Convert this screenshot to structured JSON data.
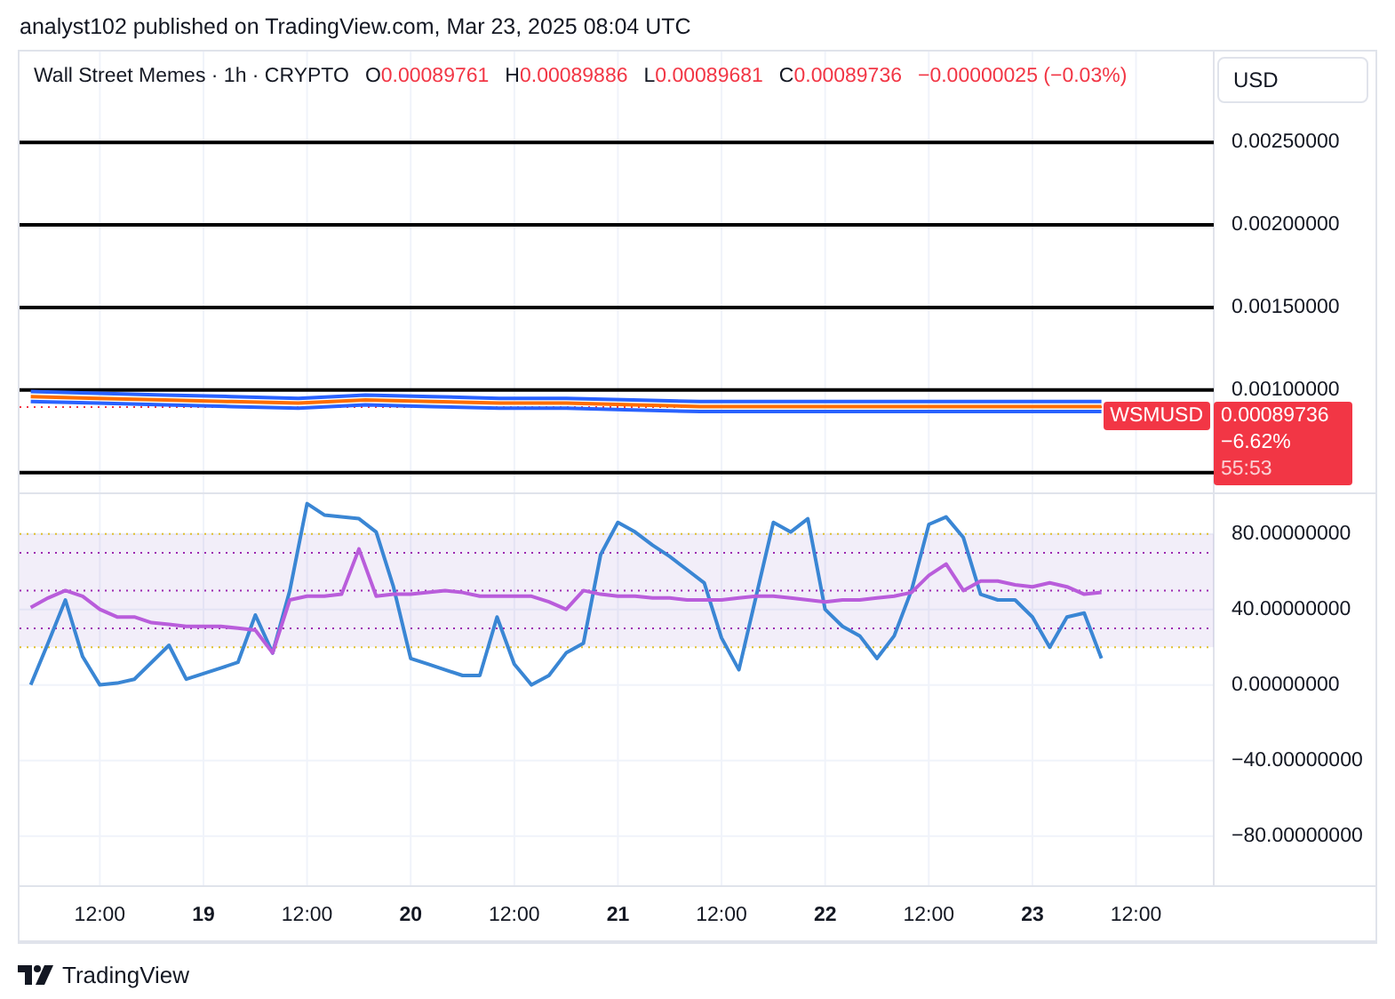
{
  "header": {
    "text": "analyst102 published on TradingView.com, Mar 23, 2025 08:04 UTC"
  },
  "legend": {
    "symbol": "Wall Street Memes · 1h · CRYPTO",
    "ohlc": [
      {
        "label": "O",
        "value": "0.00089761"
      },
      {
        "label": "H",
        "value": "0.00089886"
      },
      {
        "label": "L",
        "value": "0.00089681"
      },
      {
        "label": "C",
        "value": "0.00089736"
      }
    ],
    "change": "−0.00000025 (−0.03%)"
  },
  "currency_button": "USD",
  "price_pane": {
    "symbol_tag": "WSMUSD",
    "last_price": "0.00089736",
    "change_percent": "−6.62%",
    "countdown": "55:53",
    "chart_data": {
      "type": "line",
      "ylim": [
        0.00038,
        0.00305
      ],
      "categories": [
        null,
        null,
        null,
        null,
        null,
        null,
        null,
        null,
        null,
        null,
        null,
        null,
        null,
        null,
        null,
        null,
        null
      ],
      "yticks": [
        {
          "value": 0.0025,
          "label": "0.00250000"
        },
        {
          "value": 0.002,
          "label": "0.00200000"
        },
        {
          "value": 0.0015,
          "label": "0.00150000"
        },
        {
          "value": 0.001,
          "label": "0.00100000"
        }
      ],
      "series": [
        {
          "color": "#2962ff",
          "values": [
            0.00099,
            0.00098,
            0.00097,
            0.00096,
            0.00095,
            0.00097,
            0.00096,
            0.00095,
            0.00095,
            0.00094,
            0.00093,
            0.00093,
            0.00093,
            0.00093,
            0.00093,
            0.00093,
            0.00093
          ]
        },
        {
          "color": "#2962ff",
          "values": [
            0.00093,
            0.00092,
            0.00091,
            0.0009,
            0.00089,
            0.00091,
            0.0009,
            0.00089,
            0.00089,
            0.00088,
            0.00087,
            0.00087,
            0.00087,
            0.00087,
            0.00087,
            0.00087,
            0.00087
          ]
        },
        {
          "color": "#ff6d00",
          "values": [
            0.00096,
            0.00095,
            0.00094,
            0.00093,
            0.00092,
            0.00094,
            0.00093,
            0.00092,
            0.00092,
            0.00091,
            0.0009,
            0.0009,
            0.0009,
            0.0009,
            0.0009,
            0.0009,
            0.0009
          ]
        }
      ],
      "grid": true,
      "ref_lines": [
        {
          "axis": "y",
          "value": 0.0025,
          "color": "#000000"
        },
        {
          "axis": "y",
          "value": 0.002,
          "color": "#000000"
        },
        {
          "axis": "y",
          "value": 0.0015,
          "color": "#000000"
        },
        {
          "axis": "y",
          "value": 0.001,
          "color": "#000000"
        },
        {
          "axis": "y",
          "value": 0.0005,
          "color": "#000000"
        },
        {
          "axis": "y",
          "value": 0.00089736,
          "color": "#f23645"
        }
      ]
    }
  },
  "oscillator_pane": {
    "chart_data": {
      "type": "line",
      "ylim": [
        -107,
        101
      ],
      "categories": [
        null,
        null,
        null,
        null,
        "12:00",
        null,
        null,
        null,
        null,
        null,
        "19",
        null,
        null,
        null,
        null,
        null,
        "12:00",
        null,
        null,
        null,
        null,
        null,
        "20",
        null,
        null,
        null,
        null,
        null,
        "12:00",
        null,
        null,
        null,
        null,
        null,
        "21",
        null,
        null,
        null,
        null,
        null,
        "12:00",
        null,
        null,
        null,
        null,
        null,
        "22",
        null,
        null,
        null,
        null,
        null,
        "12:00",
        null,
        null,
        null,
        null,
        null,
        "23",
        null,
        null,
        null,
        null,
        null,
        "12:00"
      ],
      "yticks": [
        {
          "value": 80,
          "label": "80.00000000"
        },
        {
          "value": 40,
          "label": "40.00000000"
        },
        {
          "value": 0,
          "label": "0.00000000"
        },
        {
          "value": -40,
          "label": "−40.00000000"
        },
        {
          "value": -80,
          "label": "−80.00000000"
        }
      ],
      "series": [
        {
          "color": "#3a86d4",
          "values": [
            0,
            22,
            45,
            15,
            0,
            1,
            3,
            12,
            21,
            3,
            6,
            9,
            12,
            37,
            17,
            50,
            96,
            90,
            89,
            88,
            81,
            52,
            14,
            11,
            8,
            5,
            5,
            36,
            11,
            0,
            5,
            17,
            22,
            69,
            86,
            81,
            74,
            68,
            61,
            54,
            25,
            8,
            47,
            86,
            81,
            88,
            40,
            31,
            26,
            14,
            26,
            50,
            85,
            89,
            78,
            48,
            45,
            45,
            36,
            20,
            36,
            38,
            14,
            null,
            null
          ]
        },
        {
          "color": "#b95ddb",
          "values": [
            41,
            46,
            50,
            47,
            40,
            36,
            36,
            33,
            32,
            31,
            31,
            31,
            30,
            29,
            17,
            45,
            47,
            47,
            48,
            72,
            47,
            48,
            48,
            49,
            50,
            49,
            47,
            47,
            47,
            47,
            44,
            40,
            50,
            48,
            47,
            47,
            46,
            46,
            45,
            45,
            45,
            46,
            47,
            47,
            46,
            45,
            44,
            45,
            45,
            46,
            47,
            49,
            58,
            64,
            50,
            55,
            55,
            53,
            52,
            54,
            52,
            48,
            49,
            null,
            null
          ]
        }
      ],
      "grid": true,
      "bands": [
        {
          "axis": "y",
          "from": 20,
          "to": 80,
          "color": "#7e57c2"
        }
      ],
      "ref_lines": [
        {
          "axis": "y",
          "value": 80,
          "color": "#e0c030"
        },
        {
          "axis": "y",
          "value": 70,
          "color": "#9c27b0"
        },
        {
          "axis": "y",
          "value": 50,
          "color": "#9c27b0"
        },
        {
          "axis": "y",
          "value": 30,
          "color": "#9c27b0"
        },
        {
          "axis": "y",
          "value": 20,
          "color": "#e0c030"
        }
      ]
    }
  },
  "footer": {
    "brand": "TradingView"
  }
}
